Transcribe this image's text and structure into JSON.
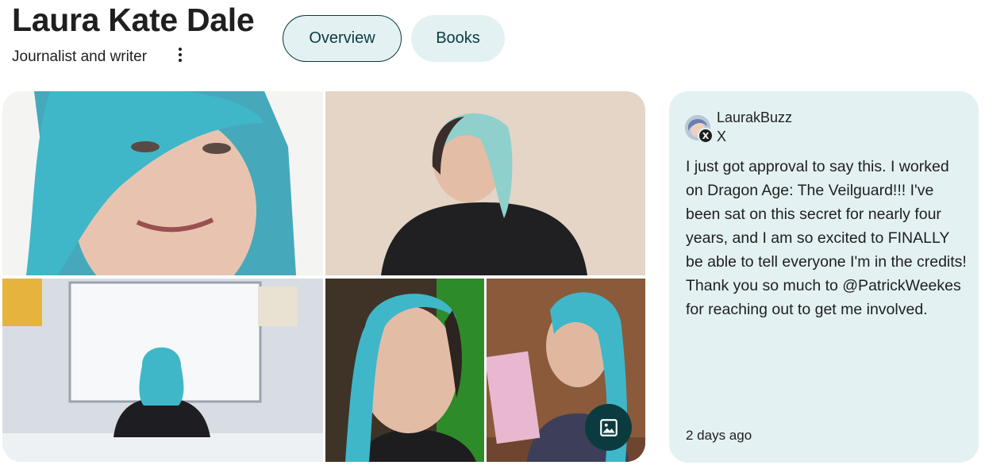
{
  "profile": {
    "name": "Laura Kate Dale",
    "subtitle": "Journalist and writer",
    "more_options_icon": "more-vert-icon"
  },
  "tabs": [
    {
      "label": "Overview",
      "selected": true
    },
    {
      "label": "Books",
      "selected": false
    }
  ],
  "gallery": {
    "view_more_icon": "image-icon"
  },
  "social_post": {
    "handle": "LaurakBuzz",
    "platform": "X",
    "platform_badge": "X",
    "text": "I just got approval to say this. I worked on Dragon Age: The Veilguard!!! I've been sat on this secret for nearly four years, and I am so excited to FINALLY be able to tell everyone I'm in the credits! Thank you so much to @PatrickWeekes for reaching out to get me involved.",
    "time": "2 days ago"
  },
  "colors": {
    "accent_dark": "#0b3b3f",
    "chip_bg": "#e3f1f3",
    "card_bg": "#e3f1f3",
    "hair_teal": "#3fb7c9"
  }
}
